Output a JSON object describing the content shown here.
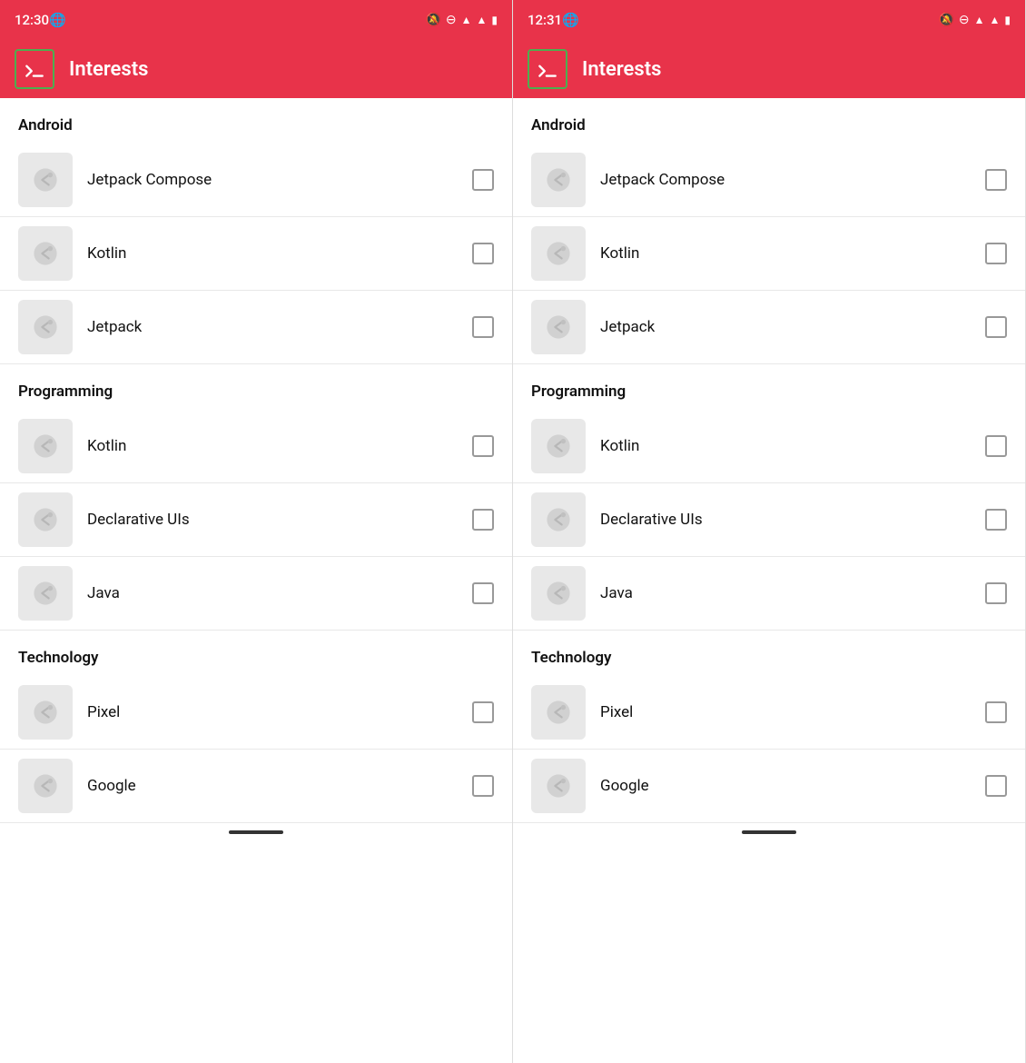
{
  "panels": [
    {
      "id": "left",
      "status": {
        "time": "12:30",
        "icons": [
          "🔕",
          "⊖",
          "▲",
          "▮"
        ]
      },
      "appbar": {
        "title": "Interests"
      },
      "sections": [
        {
          "label": "Android",
          "items": [
            {
              "name": "Jetpack Compose"
            },
            {
              "name": "Kotlin"
            },
            {
              "name": "Jetpack"
            }
          ]
        },
        {
          "label": "Programming",
          "items": [
            {
              "name": "Kotlin"
            },
            {
              "name": "Declarative UIs"
            },
            {
              "name": "Java"
            }
          ]
        },
        {
          "label": "Technology",
          "items": [
            {
              "name": "Pixel"
            },
            {
              "name": "Google"
            }
          ]
        }
      ]
    },
    {
      "id": "right",
      "status": {
        "time": "12:31",
        "icons": [
          "🔕",
          "⊖",
          "▲",
          "▮"
        ]
      },
      "appbar": {
        "title": "Interests"
      },
      "sections": [
        {
          "label": "Android",
          "items": [
            {
              "name": "Jetpack Compose"
            },
            {
              "name": "Kotlin"
            },
            {
              "name": "Jetpack"
            }
          ]
        },
        {
          "label": "Programming",
          "items": [
            {
              "name": "Kotlin"
            },
            {
              "name": "Declarative UIs"
            },
            {
              "name": "Java"
            }
          ]
        },
        {
          "label": "Technology",
          "items": [
            {
              "name": "Pixel"
            },
            {
              "name": "Google"
            }
          ]
        }
      ]
    }
  ]
}
